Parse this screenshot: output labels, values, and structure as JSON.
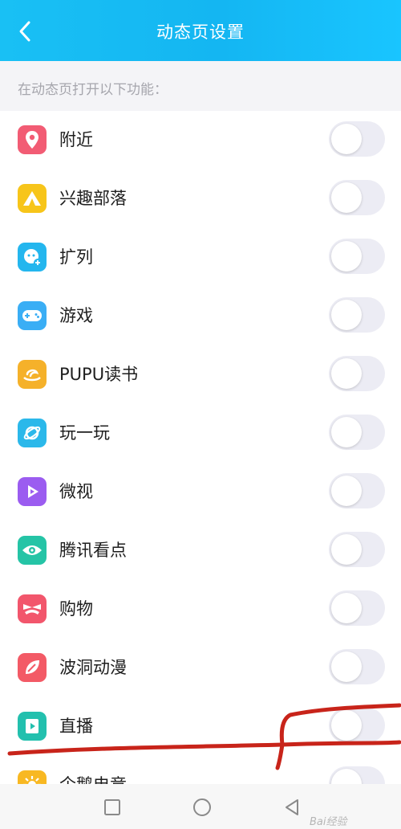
{
  "header": {
    "title": "动态页设置",
    "back_icon": "chevron-left-icon"
  },
  "section": {
    "caption": "在动态页打开以下功能："
  },
  "items": [
    {
      "label": "附近",
      "icon": "location-pin-icon",
      "color": "#f25c74",
      "enabled": false
    },
    {
      "label": "兴趣部落",
      "icon": "tent-icon",
      "color": "#f7c51a",
      "enabled": false
    },
    {
      "label": "扩列",
      "icon": "face-plus-icon",
      "color": "#24b6ee",
      "enabled": false
    },
    {
      "label": "游戏",
      "icon": "gamepad-icon",
      "color": "#3aaef5",
      "enabled": false
    },
    {
      "label": "PUPU读书",
      "icon": "book-swirl-icon",
      "color": "#f5b12a",
      "enabled": false
    },
    {
      "label": "玩一玩",
      "icon": "planet-icon",
      "color": "#2bb8ea",
      "enabled": false
    },
    {
      "label": "微视",
      "icon": "play-icon",
      "color": "#9b5cf0",
      "enabled": false
    },
    {
      "label": "腾讯看点",
      "icon": "eye-icon",
      "color": "#25c4a6",
      "enabled": false
    },
    {
      "label": "购物",
      "icon": "bow-icon",
      "color": "#f2566c",
      "enabled": false
    },
    {
      "label": "波洞动漫",
      "icon": "leaf-icon",
      "color": "#f35a66",
      "enabled": false
    },
    {
      "label": "直播",
      "icon": "live-play-icon",
      "color": "#23c0ae",
      "enabled": false
    },
    {
      "label": "企鹅电竞",
      "icon": "sun-icon",
      "color": "#f8b822",
      "enabled": false
    }
  ],
  "navbar": {
    "icons": [
      "square-icon",
      "circle-icon",
      "triangle-back-icon"
    ]
  },
  "watermark": "Bai经验",
  "annotation": {
    "color": "#c8241a"
  }
}
